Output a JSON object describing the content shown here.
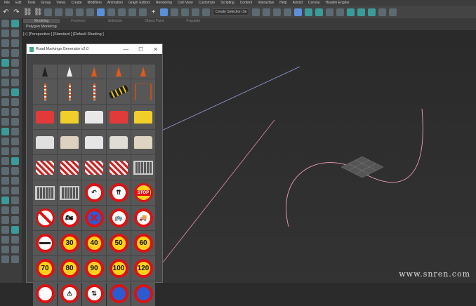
{
  "menu": [
    "File",
    "Edit",
    "Tools",
    "Group",
    "Views",
    "Create",
    "Modifiers",
    "Animation",
    "Graph Editors",
    "Rendering",
    "Civil View",
    "Customize",
    "Scripting",
    "Content",
    "Interactive",
    "Help",
    "Arnold",
    "Corona",
    "Houdini Engine"
  ],
  "toolbar": {
    "selection_set": "Create Selection Se"
  },
  "ribbon": {
    "tabs": [
      "Modeling",
      "Freeform",
      "Selection",
      "Object Paint",
      "Populate"
    ],
    "active": "Modeling",
    "subtitle": "Polygon Modeling"
  },
  "viewport": {
    "label": "[+] [Perspective ] [Standard ] [Default Shading ]"
  },
  "window": {
    "title": "Road Markings Generator v2.0",
    "minimize": "—",
    "maximize": "☐",
    "close": "✕"
  },
  "items": [
    {
      "type": "cone",
      "color": "#222"
    },
    {
      "type": "cone",
      "color": "#eee"
    },
    {
      "type": "cone",
      "color": "#e05a1a"
    },
    {
      "type": "cone",
      "color": "#e05a1a"
    },
    {
      "type": "cone",
      "color": "#e05a1a"
    },
    {
      "type": "post"
    },
    {
      "type": "post"
    },
    {
      "type": "post"
    },
    {
      "type": "bump"
    },
    {
      "type": "chainpost"
    },
    {
      "type": "barrier",
      "color": "#e23a3a"
    },
    {
      "type": "barrier",
      "color": "#f0cf2a"
    },
    {
      "type": "barrier",
      "color": "#e8e8e8"
    },
    {
      "type": "barrier",
      "color": "#e23a3a"
    },
    {
      "type": "barrier",
      "color": "#f0cf2a"
    },
    {
      "type": "barrier",
      "color": "#e0e0e0"
    },
    {
      "type": "barrier",
      "color": "#ddd2c0"
    },
    {
      "type": "barrier",
      "color": "#e6e6e6"
    },
    {
      "type": "barrier",
      "color": "#e0ddd6"
    },
    {
      "type": "barrier",
      "color": "#ddd4c2"
    },
    {
      "type": "striped"
    },
    {
      "type": "striped"
    },
    {
      "type": "striped"
    },
    {
      "type": "striped"
    },
    {
      "type": "fence"
    },
    {
      "type": "fence"
    },
    {
      "type": "fence"
    },
    {
      "type": "prohib",
      "label": "↶"
    },
    {
      "type": "prohib",
      "label": "⇈"
    },
    {
      "type": "stop",
      "label": "STOP"
    },
    {
      "type": "noentry-white"
    },
    {
      "type": "prohib",
      "label": "🏍"
    },
    {
      "type": "bluex",
      "label": "✕"
    },
    {
      "type": "prohib",
      "label": "🚌"
    },
    {
      "type": "prohib",
      "label": "🚚"
    },
    {
      "type": "noentry"
    },
    {
      "type": "speed",
      "label": "30"
    },
    {
      "type": "speed",
      "label": "40"
    },
    {
      "type": "speed",
      "label": "50"
    },
    {
      "type": "speed",
      "label": "60"
    },
    {
      "type": "speed",
      "label": "70"
    },
    {
      "type": "speed",
      "label": "80"
    },
    {
      "type": "speed",
      "label": "90"
    },
    {
      "type": "speed",
      "label": "100"
    },
    {
      "type": "speed",
      "label": "120"
    },
    {
      "type": "prohib",
      "label": ""
    },
    {
      "type": "prohib",
      "label": "⚠"
    },
    {
      "type": "prohib",
      "label": "⇅"
    },
    {
      "type": "bluex",
      "label": ""
    },
    {
      "type": "bluex",
      "label": ""
    }
  ],
  "watermark": "www.snren.com"
}
